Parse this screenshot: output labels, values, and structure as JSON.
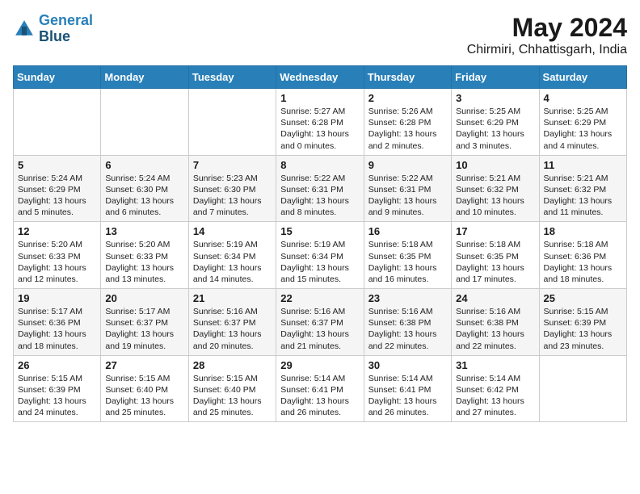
{
  "header": {
    "logo_line1": "General",
    "logo_line2": "Blue",
    "month": "May 2024",
    "location": "Chirmiri, Chhattisgarh, India"
  },
  "weekdays": [
    "Sunday",
    "Monday",
    "Tuesday",
    "Wednesday",
    "Thursday",
    "Friday",
    "Saturday"
  ],
  "weeks": [
    [
      {
        "day": "",
        "info": ""
      },
      {
        "day": "",
        "info": ""
      },
      {
        "day": "",
        "info": ""
      },
      {
        "day": "1",
        "info": "Sunrise: 5:27 AM\nSunset: 6:28 PM\nDaylight: 13 hours\nand 0 minutes."
      },
      {
        "day": "2",
        "info": "Sunrise: 5:26 AM\nSunset: 6:28 PM\nDaylight: 13 hours\nand 2 minutes."
      },
      {
        "day": "3",
        "info": "Sunrise: 5:25 AM\nSunset: 6:29 PM\nDaylight: 13 hours\nand 3 minutes."
      },
      {
        "day": "4",
        "info": "Sunrise: 5:25 AM\nSunset: 6:29 PM\nDaylight: 13 hours\nand 4 minutes."
      }
    ],
    [
      {
        "day": "5",
        "info": "Sunrise: 5:24 AM\nSunset: 6:29 PM\nDaylight: 13 hours\nand 5 minutes."
      },
      {
        "day": "6",
        "info": "Sunrise: 5:24 AM\nSunset: 6:30 PM\nDaylight: 13 hours\nand 6 minutes."
      },
      {
        "day": "7",
        "info": "Sunrise: 5:23 AM\nSunset: 6:30 PM\nDaylight: 13 hours\nand 7 minutes."
      },
      {
        "day": "8",
        "info": "Sunrise: 5:22 AM\nSunset: 6:31 PM\nDaylight: 13 hours\nand 8 minutes."
      },
      {
        "day": "9",
        "info": "Sunrise: 5:22 AM\nSunset: 6:31 PM\nDaylight: 13 hours\nand 9 minutes."
      },
      {
        "day": "10",
        "info": "Sunrise: 5:21 AM\nSunset: 6:32 PM\nDaylight: 13 hours\nand 10 minutes."
      },
      {
        "day": "11",
        "info": "Sunrise: 5:21 AM\nSunset: 6:32 PM\nDaylight: 13 hours\nand 11 minutes."
      }
    ],
    [
      {
        "day": "12",
        "info": "Sunrise: 5:20 AM\nSunset: 6:33 PM\nDaylight: 13 hours\nand 12 minutes."
      },
      {
        "day": "13",
        "info": "Sunrise: 5:20 AM\nSunset: 6:33 PM\nDaylight: 13 hours\nand 13 minutes."
      },
      {
        "day": "14",
        "info": "Sunrise: 5:19 AM\nSunset: 6:34 PM\nDaylight: 13 hours\nand 14 minutes."
      },
      {
        "day": "15",
        "info": "Sunrise: 5:19 AM\nSunset: 6:34 PM\nDaylight: 13 hours\nand 15 minutes."
      },
      {
        "day": "16",
        "info": "Sunrise: 5:18 AM\nSunset: 6:35 PM\nDaylight: 13 hours\nand 16 minutes."
      },
      {
        "day": "17",
        "info": "Sunrise: 5:18 AM\nSunset: 6:35 PM\nDaylight: 13 hours\nand 17 minutes."
      },
      {
        "day": "18",
        "info": "Sunrise: 5:18 AM\nSunset: 6:36 PM\nDaylight: 13 hours\nand 18 minutes."
      }
    ],
    [
      {
        "day": "19",
        "info": "Sunrise: 5:17 AM\nSunset: 6:36 PM\nDaylight: 13 hours\nand 18 minutes."
      },
      {
        "day": "20",
        "info": "Sunrise: 5:17 AM\nSunset: 6:37 PM\nDaylight: 13 hours\nand 19 minutes."
      },
      {
        "day": "21",
        "info": "Sunrise: 5:16 AM\nSunset: 6:37 PM\nDaylight: 13 hours\nand 20 minutes."
      },
      {
        "day": "22",
        "info": "Sunrise: 5:16 AM\nSunset: 6:37 PM\nDaylight: 13 hours\nand 21 minutes."
      },
      {
        "day": "23",
        "info": "Sunrise: 5:16 AM\nSunset: 6:38 PM\nDaylight: 13 hours\nand 22 minutes."
      },
      {
        "day": "24",
        "info": "Sunrise: 5:16 AM\nSunset: 6:38 PM\nDaylight: 13 hours\nand 22 minutes."
      },
      {
        "day": "25",
        "info": "Sunrise: 5:15 AM\nSunset: 6:39 PM\nDaylight: 13 hours\nand 23 minutes."
      }
    ],
    [
      {
        "day": "26",
        "info": "Sunrise: 5:15 AM\nSunset: 6:39 PM\nDaylight: 13 hours\nand 24 minutes."
      },
      {
        "day": "27",
        "info": "Sunrise: 5:15 AM\nSunset: 6:40 PM\nDaylight: 13 hours\nand 25 minutes."
      },
      {
        "day": "28",
        "info": "Sunrise: 5:15 AM\nSunset: 6:40 PM\nDaylight: 13 hours\nand 25 minutes."
      },
      {
        "day": "29",
        "info": "Sunrise: 5:14 AM\nSunset: 6:41 PM\nDaylight: 13 hours\nand 26 minutes."
      },
      {
        "day": "30",
        "info": "Sunrise: 5:14 AM\nSunset: 6:41 PM\nDaylight: 13 hours\nand 26 minutes."
      },
      {
        "day": "31",
        "info": "Sunrise: 5:14 AM\nSunset: 6:42 PM\nDaylight: 13 hours\nand 27 minutes."
      },
      {
        "day": "",
        "info": ""
      }
    ]
  ]
}
